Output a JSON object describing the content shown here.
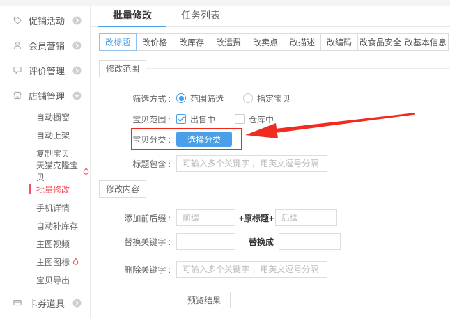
{
  "colors": {
    "accent_blue": "#4aa0e8",
    "active_subtab_border": "#8fc3ee",
    "sidebar_active_red": "#f4515c",
    "annotation_red": "#f0281e"
  },
  "sidebar": {
    "groups": [
      {
        "label": "促销活动",
        "icon": "tag-icon",
        "expanded": false
      },
      {
        "label": "会员营销",
        "icon": "user-icon",
        "expanded": false
      },
      {
        "label": "评价管理",
        "icon": "comment-icon",
        "expanded": false
      },
      {
        "label": "店铺管理",
        "icon": "shop-icon",
        "expanded": true
      },
      {
        "label": "卡券道具",
        "icon": "card-icon",
        "expanded": false
      }
    ],
    "shop_subitems": [
      {
        "label": "自动橱窗",
        "active": false,
        "hot": false
      },
      {
        "label": "自动上架",
        "active": false,
        "hot": false
      },
      {
        "label": "复制宝贝",
        "active": false,
        "hot": false
      },
      {
        "label": "天猫克隆宝贝",
        "active": false,
        "hot": true
      },
      {
        "label": "批量修改",
        "active": true,
        "hot": false
      },
      {
        "label": "手机详情",
        "active": false,
        "hot": false
      },
      {
        "label": "自动补库存",
        "active": false,
        "hot": false
      },
      {
        "label": "主图视频",
        "active": false,
        "hot": false
      },
      {
        "label": "主图图标",
        "active": false,
        "hot": true
      },
      {
        "label": "宝贝导出",
        "active": false,
        "hot": false
      }
    ]
  },
  "main": {
    "tabs": [
      {
        "label": "批量修改",
        "active": true
      },
      {
        "label": "任务列表",
        "active": false
      }
    ],
    "subtabs": [
      {
        "label": "改标题",
        "active": true
      },
      {
        "label": "改价格",
        "active": false
      },
      {
        "label": "改库存",
        "active": false
      },
      {
        "label": "改运费",
        "active": false
      },
      {
        "label": "改卖点",
        "active": false
      },
      {
        "label": "改描述",
        "active": false
      },
      {
        "label": "改编码",
        "active": false
      },
      {
        "label": "改食品安全",
        "active": false
      },
      {
        "label": "改基本信息",
        "active": false
      }
    ],
    "scope_section": {
      "legend": "修改范围",
      "filter_row": {
        "label": "筛选方式 :",
        "options": [
          {
            "label": "范围筛选",
            "checked": true
          },
          {
            "label": "指定宝贝",
            "checked": false
          }
        ]
      },
      "range_row": {
        "label": "宝贝范围 :",
        "options": [
          {
            "label": "出售中",
            "checked": true
          },
          {
            "label": "仓库中",
            "checked": false
          }
        ]
      },
      "category_row": {
        "label": "宝贝分类 :",
        "button_label": "选择分类"
      },
      "title_row": {
        "label": "标题包含 :",
        "value": "",
        "placeholder": "可输入多个关键字 ，用英文逗号分隔"
      }
    },
    "content_section": {
      "legend": "修改内容",
      "affix_row": {
        "label": "添加前后缀 :",
        "prefix_placeholder": "前缀",
        "middle_text": "+原标题+",
        "suffix_placeholder": "后缀"
      },
      "replace_row": {
        "label": "替换关键字 :",
        "middle_text": "替换成",
        "find_value": "",
        "replace_value": ""
      },
      "delete_row": {
        "label": "删除关键字 :",
        "value": "",
        "placeholder": "可输入多个关键字 ，用英文逗号分隔"
      },
      "preview_button": "预览结果"
    }
  }
}
